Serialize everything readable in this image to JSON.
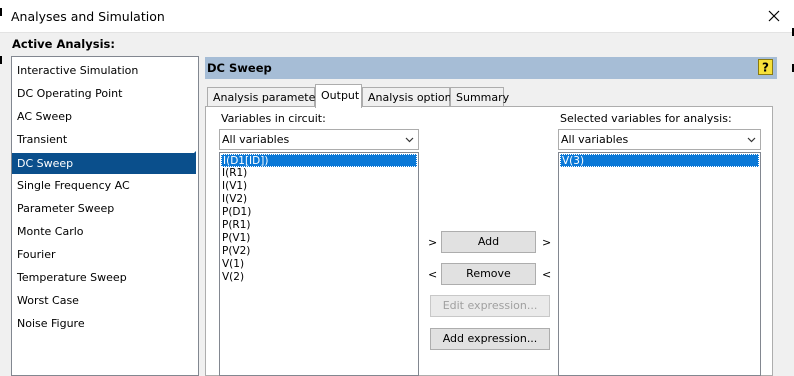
{
  "window": {
    "title": "Analyses and Simulation",
    "active_label": "Active Analysis:"
  },
  "analyses": [
    "Interactive Simulation",
    "DC Operating Point",
    "AC Sweep",
    "Transient",
    "DC Sweep",
    "Single Frequency AC",
    "Parameter Sweep",
    "Monte Carlo",
    "Fourier",
    "Temperature Sweep",
    "Worst Case",
    "Noise Figure"
  ],
  "selected_analysis": "DC Sweep",
  "panel": {
    "title": "DC Sweep",
    "tabs": [
      "Analysis parameters",
      "Output",
      "Analysis options",
      "Summary"
    ],
    "active_tab": "Output"
  },
  "output": {
    "circuit_label": "Variables in circuit:",
    "circuit_filter": "All variables",
    "circuit_vars": [
      "I(D1[ID])",
      "I(R1)",
      "I(V1)",
      "I(V2)",
      "P(D1)",
      "P(R1)",
      "P(V1)",
      "P(V2)",
      "V(1)",
      "V(2)"
    ],
    "selected_label": "Selected variables for analysis:",
    "selected_filter": "All variables",
    "selected_vars": [
      "V(3)"
    ],
    "add_label": "Add",
    "remove_label": "Remove",
    "edit_label": "Edit expression...",
    "add_expr_label": "Add expression...",
    "arrow_right": ">",
    "arrow_left": "<"
  },
  "colors": {
    "selection": "#0a4f8c",
    "list_selection": "#0a78d7",
    "header_bar": "#a6bdd6"
  },
  "icons": {
    "close": "close-icon",
    "help": "help-icon",
    "dropdown": "chevron-down-icon"
  }
}
